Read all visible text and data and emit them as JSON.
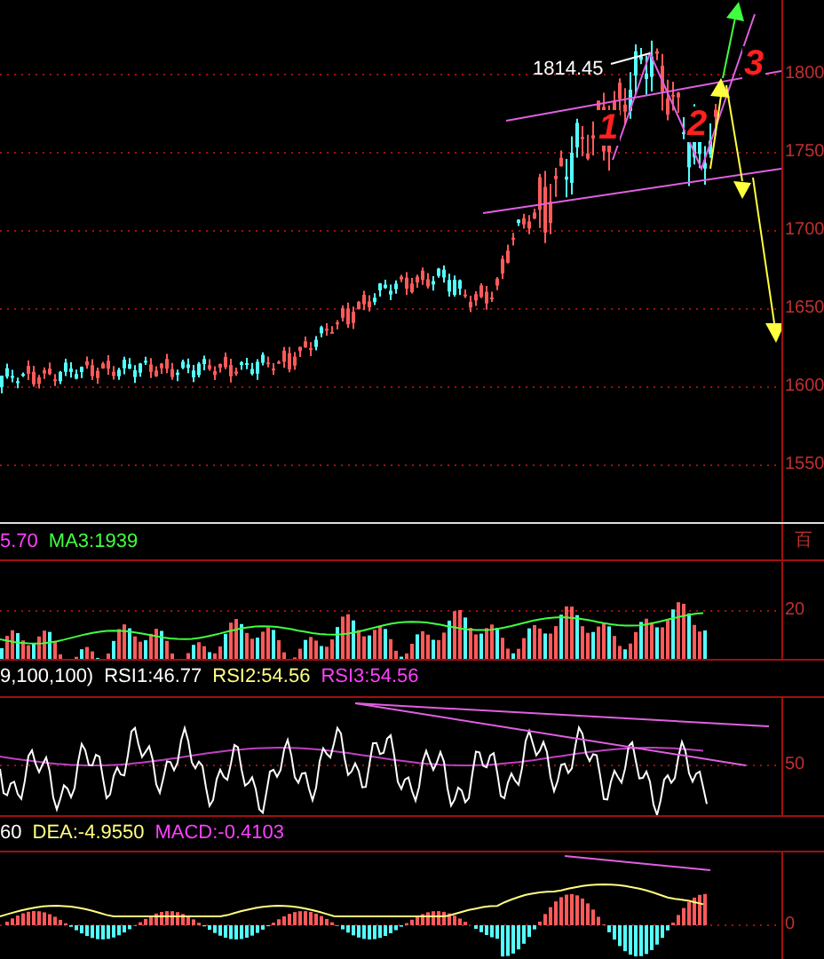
{
  "price_panel": {
    "y_axis_labels": [
      "1800",
      "1750",
      "1700",
      "1650",
      "1600",
      "1550"
    ],
    "peak_label": "1814.45",
    "wave_marks": [
      {
        "text": "1"
      },
      {
        "text": "2"
      },
      {
        "text": "3"
      }
    ]
  },
  "volume_legend": [
    {
      "text": "5.70",
      "color": "#ff40ff"
    },
    {
      "text": "MA3:1939",
      "color": "#40ff40"
    }
  ],
  "volume_panel": {
    "unit_label": "百",
    "y_axis_labels": [
      "20"
    ]
  },
  "rsi_legend": [
    {
      "text": "9,100,100)",
      "color": "#ffffff"
    },
    {
      "text": "RSI1:46.77",
      "color": "#ffffff"
    },
    {
      "text": "RSI2:54.56",
      "color": "#ffff80"
    },
    {
      "text": "RSI3:54.56",
      "color": "#ff40ff"
    }
  ],
  "rsi_panel": {
    "y_axis_labels": [
      "50"
    ]
  },
  "macd_legend": [
    {
      "text": "60",
      "color": "#ffffff"
    },
    {
      "text": "DEA:-4.9550",
      "color": "#ffff80"
    },
    {
      "text": "MACD:-0.4103",
      "color": "#ff40ff"
    }
  ],
  "macd_panel": {
    "y_axis_labels": [
      "0"
    ]
  }
}
